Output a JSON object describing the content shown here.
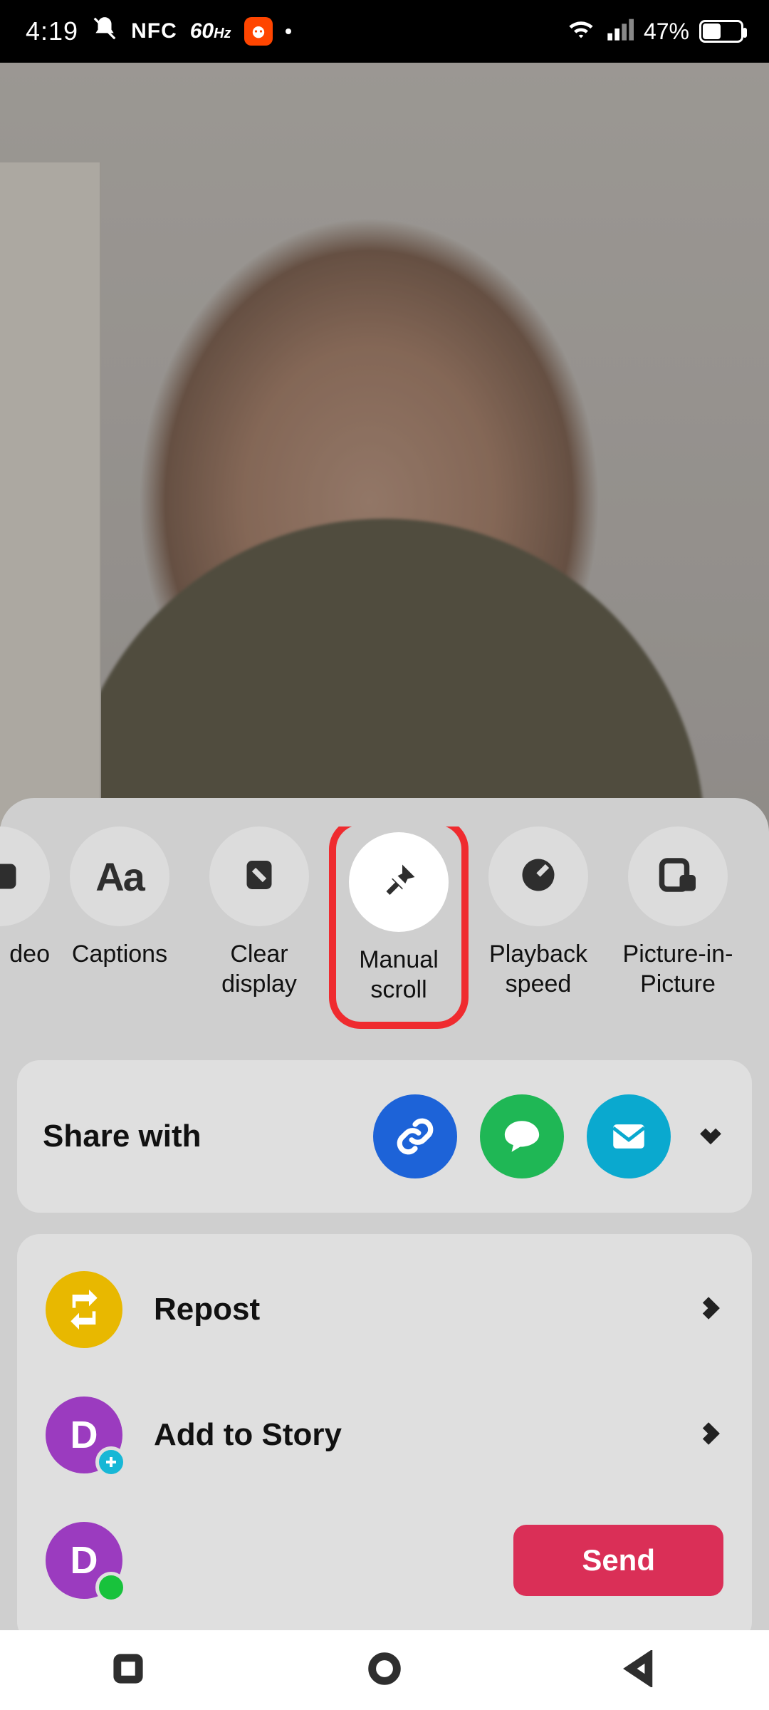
{
  "status": {
    "time": "4:19",
    "nfc": "NFC",
    "refresh_rate": "60",
    "refresh_unit": "Hz",
    "battery_pct": "47%"
  },
  "options": {
    "partial_left_label": "deo",
    "captions": "Captions",
    "clear_display": "Clear display",
    "manual_scroll": "Manual scroll",
    "playback_speed": "Playback speed",
    "pip": "Picture-in-Picture"
  },
  "share": {
    "title": "Share with"
  },
  "list": {
    "repost": "Repost",
    "add_story": "Add to Story",
    "contact_initial": "D",
    "send": "Send"
  }
}
